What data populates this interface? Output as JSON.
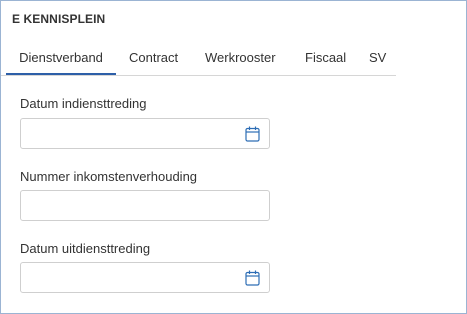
{
  "panel": {
    "title": "E KENNISPLEIN"
  },
  "tabs": [
    {
      "label": "Dienstverband",
      "active": true
    },
    {
      "label": "Contract",
      "active": false
    },
    {
      "label": "Werkrooster",
      "active": false
    },
    {
      "label": "Fiscaal",
      "active": false
    },
    {
      "label": "SV",
      "active": false
    }
  ],
  "form": {
    "start_date": {
      "label": "Datum indiensttreding",
      "value": "",
      "icon": "calendar-icon"
    },
    "income_number": {
      "label": "Nummer inkomstenverhouding",
      "value": ""
    },
    "end_date": {
      "label": "Datum uitdiensttreding",
      "value": "",
      "icon": "calendar-icon"
    }
  },
  "colors": {
    "accent": "#2d5fa8",
    "frame_border": "#9bb4d3",
    "input_border": "#cfcfcf",
    "icon": "#2d6db5"
  }
}
